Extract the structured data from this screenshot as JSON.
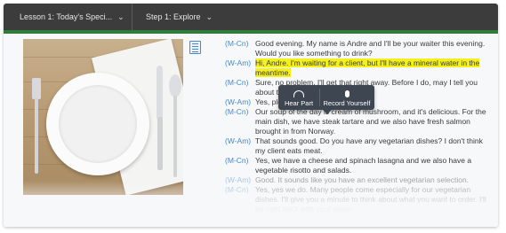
{
  "header": {
    "lesson_label": "Lesson 1: Today's Speci...",
    "step_label": "Step 1: Explore"
  },
  "popup": {
    "hear_label": "Hear Part",
    "record_label": "Record Yourself"
  },
  "dialogue": [
    {
      "speaker": "(M-Cn)",
      "text": "Good evening. My name is Andre and I'll be your waiter this evening. Would you like something to drink?"
    },
    {
      "speaker": "(W-Am)",
      "text": "Hi, Andre. I'm waiting for a client, but I'll have a mineral water in the meantime."
    },
    {
      "speaker": "(M-Cn)",
      "text": "Sure, no problem. I'll get that right away. Before I do, may I tell you about today's specials?"
    },
    {
      "speaker": "(W-Am)",
      "text": "Yes, please."
    },
    {
      "speaker": "(M-Cn)",
      "text": "Our soup of the day is cream of mushroom, and it's delicious. For the main dish, we have steak tartare and we also have fresh salmon brought in from Norway."
    },
    {
      "speaker": "(W-Am)",
      "text": "That sounds good. Do you have any vegetarian dishes? I don't think my client eats meat."
    },
    {
      "speaker": "(M-Cn)",
      "text": "Yes, we have a cheese and spinach lasagna and we also have a vegetable risotto and salads."
    },
    {
      "speaker": "(W-Am)",
      "text": "Good. It sounds like you have an excellent vegetarian selection."
    },
    {
      "speaker": "(M-Cn)",
      "text": "Yes, yes we do. Many people come especially for our vegetarian dishes. I'll give you a minute to think about what you want to order. I'll be right back with your water."
    }
  ],
  "colors": {
    "accent_green": "#2f7d3a",
    "speaker_blue": "#4a89c8",
    "highlight_yellow": "#f4f01c"
  }
}
